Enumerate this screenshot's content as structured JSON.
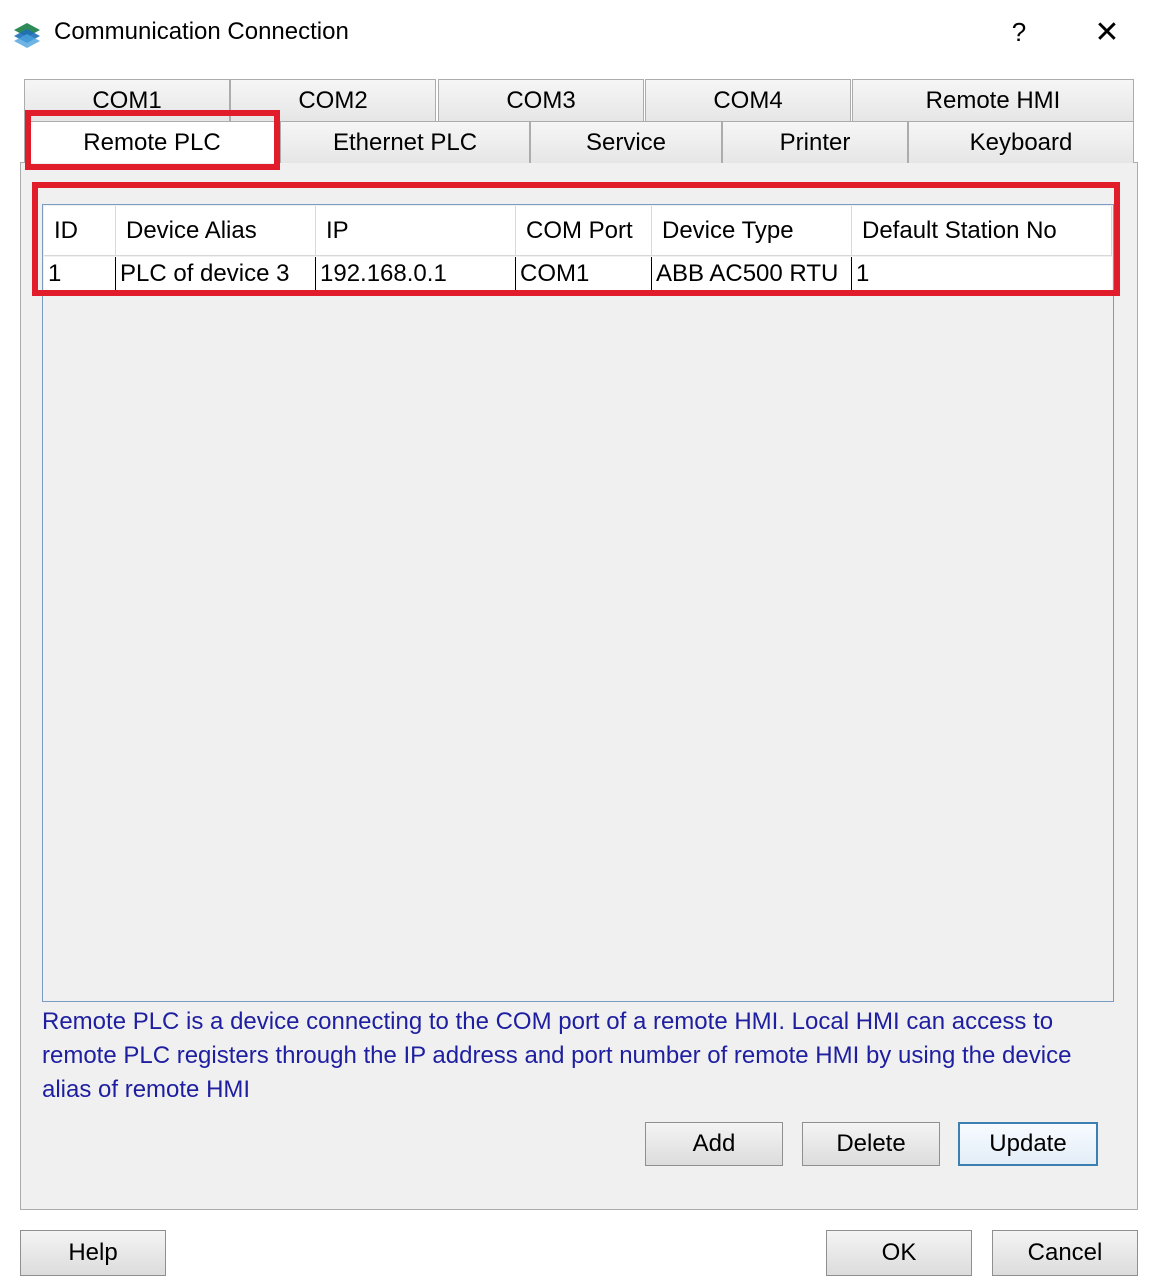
{
  "window": {
    "title": "Communication Connection",
    "help_glyph": "?",
    "close_glyph": "✕"
  },
  "tabs_row1": [
    "COM1",
    "COM2",
    "COM3",
    "COM4",
    "Remote HMI"
  ],
  "tabs_row2": [
    "Remote PLC",
    "Ethernet PLC",
    "Service",
    "Printer",
    "Keyboard"
  ],
  "active_tab": "Remote PLC",
  "table": {
    "headers": [
      "ID",
      "Device Alias",
      "IP",
      "COM Port",
      "Device Type",
      "Default Station No"
    ],
    "rows": [
      [
        "1",
        "PLC of device 3",
        "192.168.0.1",
        "COM1",
        "ABB AC500 RTU",
        "1"
      ]
    ]
  },
  "info_text": "Remote PLC is a device connecting to the COM port of a remote HMI. Local HMI can access to remote PLC registers through the IP address and port number of remote HMI by using the device alias of remote HMI",
  "buttons": {
    "add": "Add",
    "delete": "Delete",
    "update": "Update",
    "help": "Help",
    "ok": "OK",
    "cancel": "Cancel"
  },
  "colors": {
    "highlight": "#e21d2b",
    "info_text": "#1e1ea0"
  }
}
